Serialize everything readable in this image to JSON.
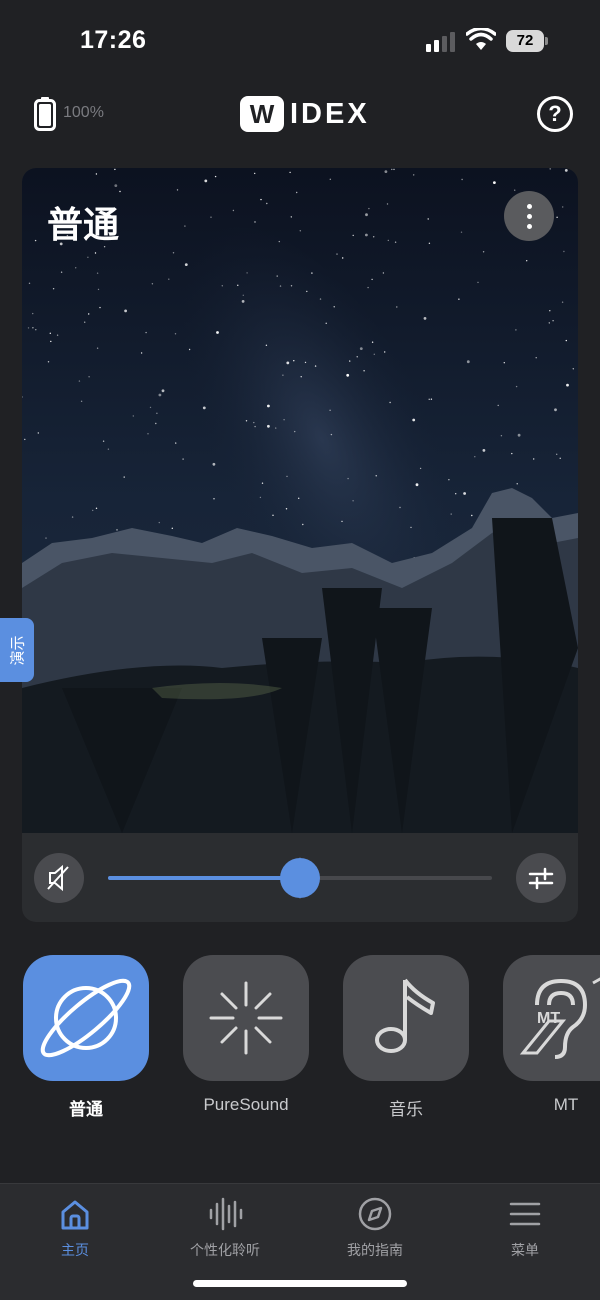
{
  "status_bar": {
    "time": "17:26",
    "battery_level": "72",
    "icons": [
      "cellular-signal-icon",
      "wifi-icon",
      "battery-icon"
    ]
  },
  "header": {
    "hearing_aid_battery": "100%",
    "logo_first_letter": "W",
    "logo_rest": "IDEX",
    "help_symbol": "?"
  },
  "program_card": {
    "title": "普通",
    "more_icon": "more-vertical-icon",
    "volume": {
      "level": 0.5,
      "mute_icon": "speaker-muted-icon",
      "adjust_icon": "sliders-icon"
    }
  },
  "demo_tab": {
    "label": "演示"
  },
  "programs": [
    {
      "label": "普通",
      "icon": "planet-icon",
      "active": true
    },
    {
      "label": "PureSound",
      "icon": "starburst-icon",
      "active": false
    },
    {
      "label": "音乐",
      "icon": "music-note-icon",
      "active": false
    },
    {
      "label": "MT",
      "icon": "hearing-loop-icon",
      "active": false
    }
  ],
  "bottom_nav": [
    {
      "label": "主页",
      "icon": "home-icon",
      "active": true
    },
    {
      "label": "个性化聆听",
      "icon": "sound-wave-icon",
      "active": false
    },
    {
      "label": "我的指南",
      "icon": "compass-icon",
      "active": false
    },
    {
      "label": "菜单",
      "icon": "hamburger-menu-icon",
      "active": false
    }
  ],
  "colors": {
    "background": "#202124",
    "card": "#2b2d30",
    "accent": "#5b8fe0",
    "tile": "#4b4c50",
    "nav_inactive": "#a0a1a5"
  }
}
